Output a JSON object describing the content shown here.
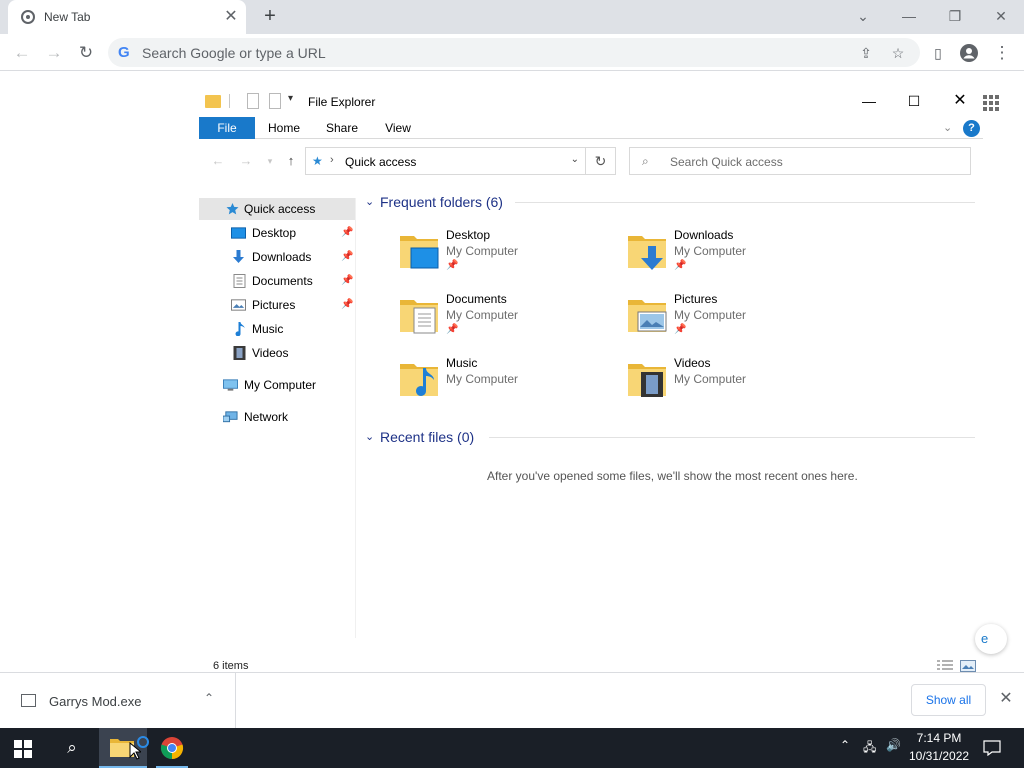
{
  "browser": {
    "tab_title": "New Tab",
    "omnibox_placeholder": "Search Google or type a URL",
    "google_g": "G"
  },
  "explorer": {
    "title": "File Explorer",
    "ribbon_tabs": [
      "File",
      "Home",
      "Share",
      "View"
    ],
    "help_label": "?",
    "address": "Quick access",
    "search_placeholder": "Search Quick access",
    "nav_items": [
      {
        "label": "Quick access",
        "icon": "star-icon"
      },
      {
        "label": "Desktop",
        "icon": "desktop-icon",
        "pinned": true
      },
      {
        "label": "Downloads",
        "icon": "download-icon",
        "pinned": true
      },
      {
        "label": "Documents",
        "icon": "document-icon",
        "pinned": true
      },
      {
        "label": "Pictures",
        "icon": "picture-icon",
        "pinned": true
      },
      {
        "label": "Music",
        "icon": "music-icon"
      },
      {
        "label": "Videos",
        "icon": "video-icon"
      },
      {
        "label": "My Computer",
        "icon": "computer-icon"
      },
      {
        "label": "Network",
        "icon": "network-icon"
      }
    ],
    "frequent_header": "Frequent folders (6)",
    "folders": [
      {
        "name": "Desktop",
        "location": "My Computer",
        "pinned": true
      },
      {
        "name": "Downloads",
        "location": "My Computer",
        "pinned": true
      },
      {
        "name": "Documents",
        "location": "My Computer",
        "pinned": true
      },
      {
        "name": "Pictures",
        "location": "My Computer",
        "pinned": true
      },
      {
        "name": "Music",
        "location": "My Computer"
      },
      {
        "name": "Videos",
        "location": "My Computer"
      }
    ],
    "recent_header": "Recent files (0)",
    "recent_empty": "After you've opened some files, we'll show the most recent ones here.",
    "status": "6 items"
  },
  "downloads_bar": {
    "file_name": "Garrys Mod.exe",
    "show_all": "Show all"
  },
  "taskbar": {
    "time": "7:14 PM",
    "date": "10/31/2022"
  },
  "colors": {
    "accent": "#1979ca",
    "section_header": "#1e3287",
    "taskbar_bg": "#1a1f27",
    "folder_yellow": "#f3c44f"
  }
}
